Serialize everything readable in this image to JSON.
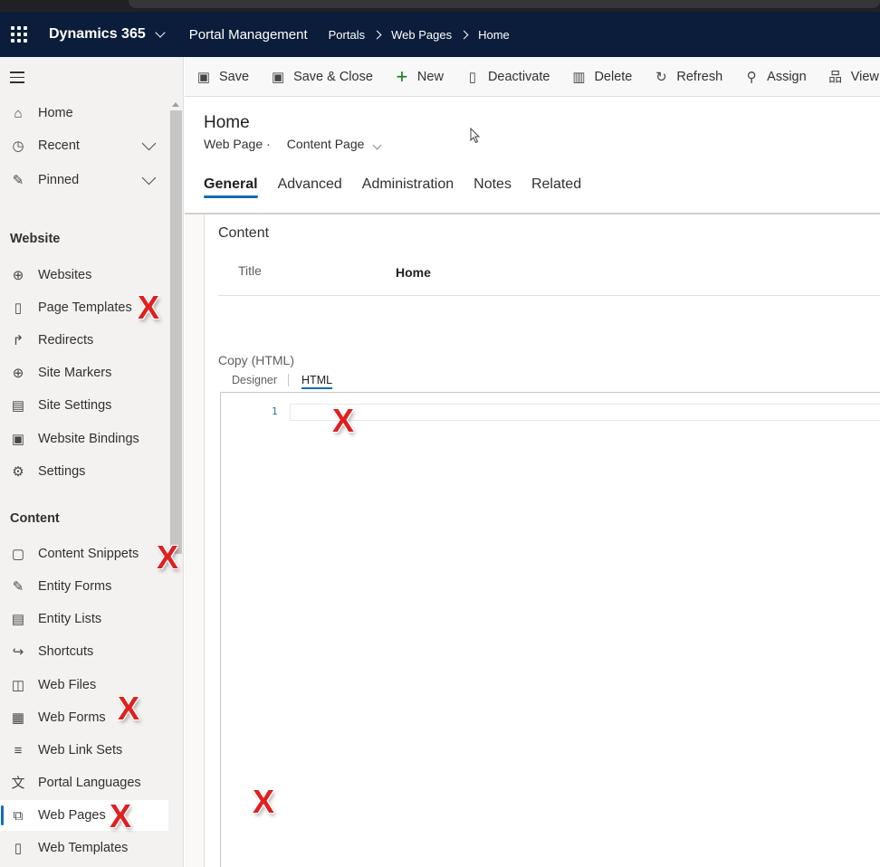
{
  "topbar": {
    "app_title": "Dynamics 365",
    "app_name": "Portal Management",
    "breadcrumb": [
      "Portals",
      "Web Pages",
      "Home"
    ]
  },
  "sidebar": {
    "top_items": [
      {
        "label": "Home",
        "icon": "home-icon"
      },
      {
        "label": "Recent",
        "icon": "clock-icon"
      },
      {
        "label": "Pinned",
        "icon": "pin-icon"
      }
    ],
    "sections": [
      {
        "title": "Website",
        "items": [
          {
            "label": "Websites",
            "icon": "globe-icon"
          },
          {
            "label": "Page Templates",
            "icon": "page-template-icon"
          },
          {
            "label": "Redirects",
            "icon": "redirect-icon"
          },
          {
            "label": "Site Markers",
            "icon": "globe-icon"
          },
          {
            "label": "Site Settings",
            "icon": "site-settings-icon"
          },
          {
            "label": "Website Bindings",
            "icon": "website-binding-icon"
          },
          {
            "label": "Settings",
            "icon": "gear-icon"
          }
        ]
      },
      {
        "title": "Content",
        "items": [
          {
            "label": "Content Snippets",
            "icon": "snippet-icon"
          },
          {
            "label": "Entity Forms",
            "icon": "form-icon"
          },
          {
            "label": "Entity Lists",
            "icon": "list-icon"
          },
          {
            "label": "Shortcuts",
            "icon": "shortcut-icon"
          },
          {
            "label": "Web Files",
            "icon": "web-file-icon"
          },
          {
            "label": "Web Forms",
            "icon": "web-form-icon"
          },
          {
            "label": "Web Link Sets",
            "icon": "link-set-icon"
          },
          {
            "label": "Portal Languages",
            "icon": "language-icon"
          },
          {
            "label": "Web Pages",
            "icon": "web-pages-icon",
            "selected": true
          },
          {
            "label": "Web Templates",
            "icon": "template-icon"
          }
        ]
      }
    ]
  },
  "commandbar": {
    "items": [
      {
        "label": "Save",
        "icon": "save-icon"
      },
      {
        "label": "Save & Close",
        "icon": "save-close-icon"
      },
      {
        "label": "New",
        "icon": "plus-icon"
      },
      {
        "label": "Deactivate",
        "icon": "deactivate-icon"
      },
      {
        "label": "Delete",
        "icon": "trash-icon"
      },
      {
        "label": "Refresh",
        "icon": "refresh-icon"
      },
      {
        "label": "Assign",
        "icon": "assign-icon"
      },
      {
        "label": "View Hie",
        "icon": "hierarchy-icon"
      }
    ]
  },
  "form": {
    "record_title": "Home",
    "entity_name": "Web Page",
    "separator": "·",
    "form_name": "Content Page",
    "tabs": [
      "General",
      "Advanced",
      "Administration",
      "Notes",
      "Related"
    ],
    "active_tab": "General",
    "section_title": "Content",
    "title_field": {
      "label": "Title",
      "value": "Home"
    },
    "copy_label": "Copy (HTML)",
    "editor_tabs": [
      "Designer",
      "HTML"
    ],
    "editor_active_tab": "HTML",
    "editor_line_number": "1"
  },
  "annotations": {
    "x_mark_text": "X",
    "accent_color": "#e02020"
  },
  "colors": {
    "topbar": "#0b1d3a",
    "accent": "#0f6cbd",
    "sidebar_bg": "#f3f2f1"
  }
}
